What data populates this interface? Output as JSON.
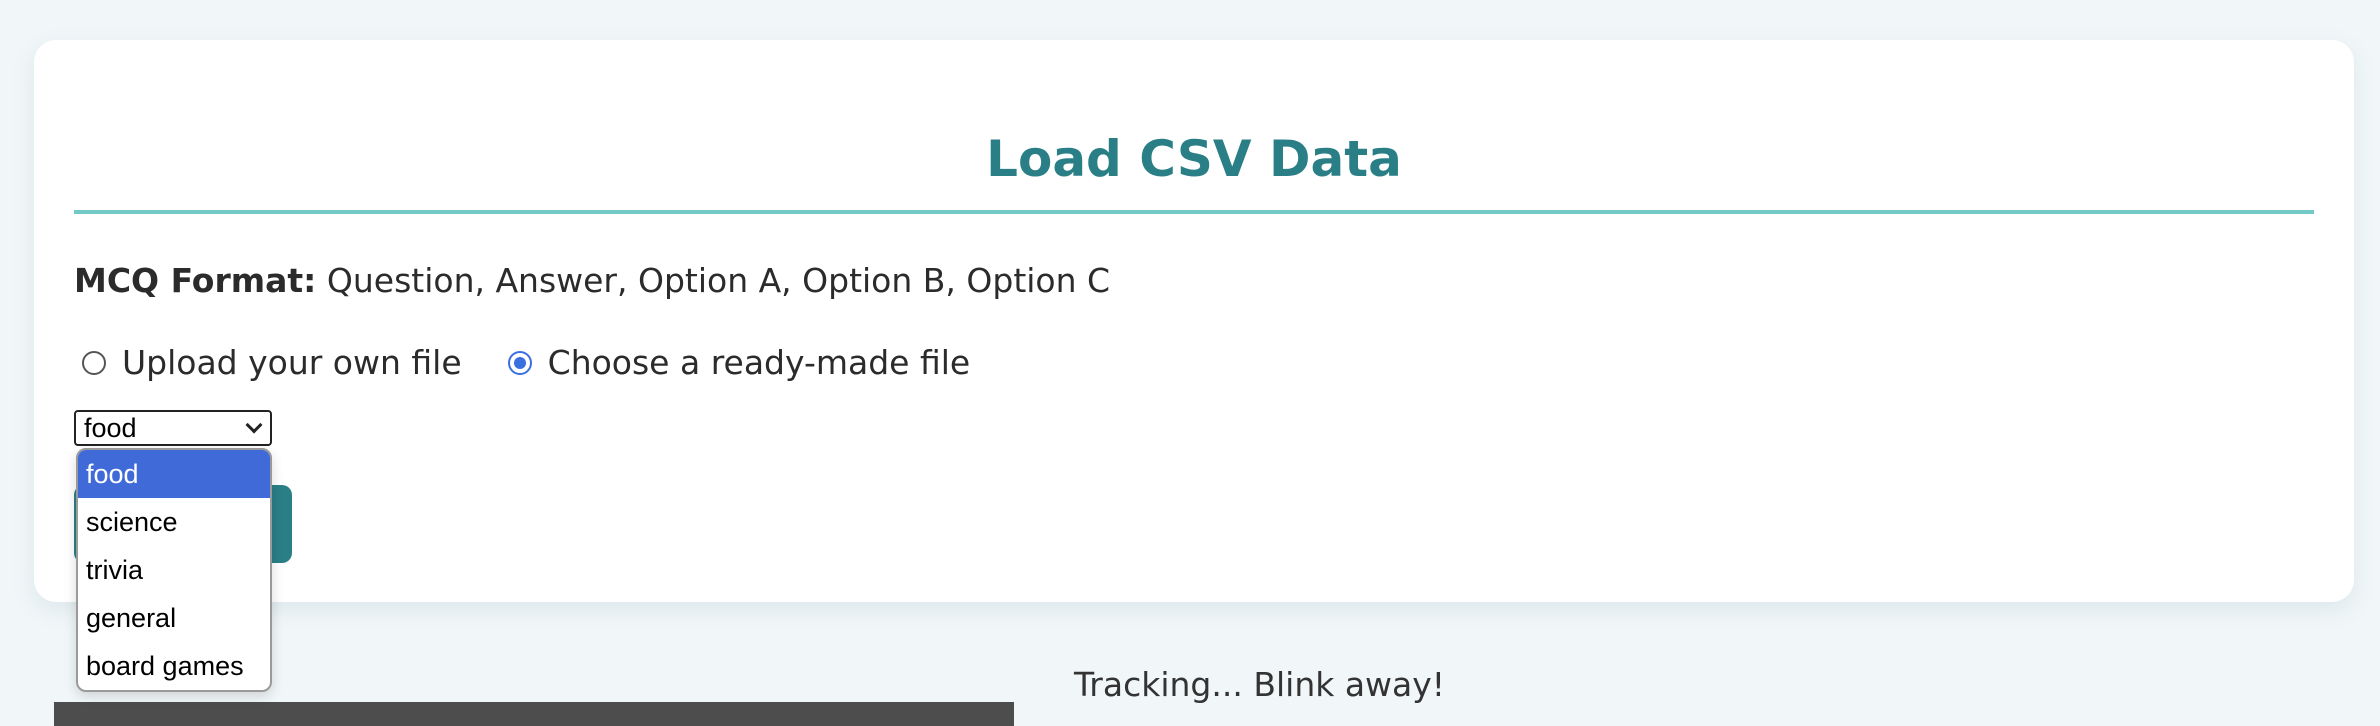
{
  "card": {
    "title": "Load CSV Data",
    "format_label": "MCQ Format:",
    "format_value": " Question, Answer, Option A, Option B, Option C",
    "radio_options": [
      {
        "label": "Upload your own file",
        "checked": false
      },
      {
        "label": "Choose a ready-made file",
        "checked": true
      }
    ],
    "select": {
      "selected": "food",
      "options": [
        "food",
        "science",
        "trivia",
        "general",
        "board games"
      ]
    }
  },
  "status": {
    "text": "Tracking... Blink away!"
  },
  "colors": {
    "accent": "#2a7f87",
    "divider": "#74c8c5",
    "selected_option": "#3f6ad8",
    "radio_checked": "#3a6fe0",
    "background": "#f1f7f9"
  }
}
